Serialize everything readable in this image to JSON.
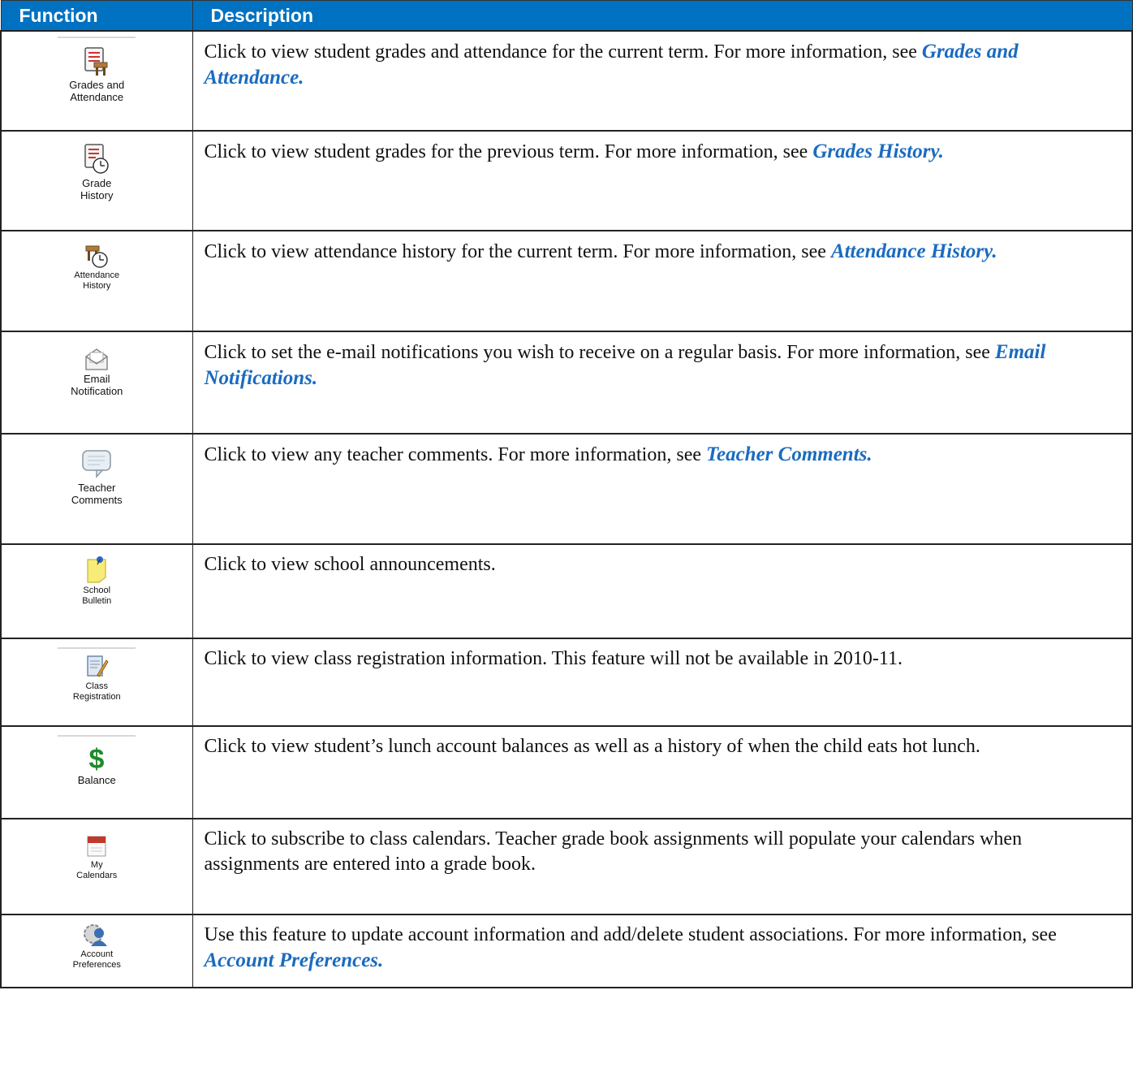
{
  "header": {
    "function": "Function",
    "description": "Description"
  },
  "rows": [
    {
      "icon": "grades-attendance-icon",
      "label": "Grades and\nAttendance",
      "text": "Click to view student grades and attendance for the current term. For more information, see ",
      "link": "Grades and Attendance."
    },
    {
      "icon": "grade-history-icon",
      "label": "Grade\nHistory",
      "text": "Click to view student grades for the previous term. For more information, see ",
      "link": "Grades History."
    },
    {
      "icon": "attendance-history-icon",
      "label": "Attendance\nHistory",
      "text": "Click to view attendance history for the current term. For more information, see ",
      "link": "Attendance History."
    },
    {
      "icon": "envelope-icon",
      "label": "Email\nNotification",
      "text": "Click to set the e-mail notifications you wish to receive on a regular basis. For more information, see ",
      "link": "Email Notifications."
    },
    {
      "icon": "speech-bubble-icon",
      "label": "Teacher\nComments",
      "text": "Click to view any teacher comments. For more information, see ",
      "link": "Teacher Comments."
    },
    {
      "icon": "sticky-note-icon",
      "label": "School\nBulletin",
      "text": "Click to view school announcements.",
      "link": ""
    },
    {
      "icon": "class-registration-icon",
      "label": "Class\nRegistration",
      "text": "Click to view class registration information. This feature will not be available in 2010-11.",
      "link": ""
    },
    {
      "icon": "dollar-icon",
      "label": "Balance",
      "text": "Click to view student’s lunch account balances as well as a history of when the child eats hot lunch.",
      "link": ""
    },
    {
      "icon": "calendar-icon",
      "label": "My\nCalendars",
      "text": "Click to subscribe to class calendars.  Teacher grade book assignments will populate your calendars when assignments are entered into a grade book.",
      "link": ""
    },
    {
      "icon": "account-preferences-icon",
      "label": "Account\nPreferences",
      "text": "Use this feature to update account information and add/delete student associations. For more information, see ",
      "link": "Account Preferences."
    }
  ]
}
